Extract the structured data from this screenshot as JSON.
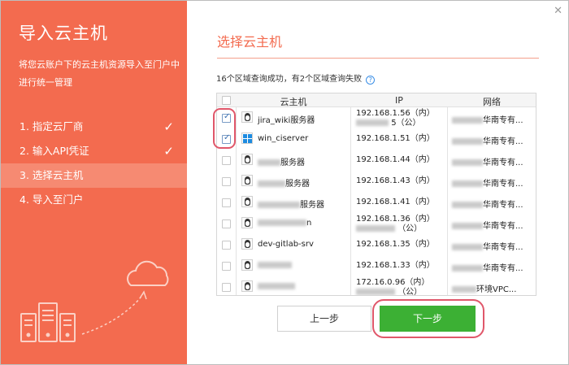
{
  "sidebar": {
    "title": "导入云主机",
    "description": "将您云账户下的云主机资源导入至门户中进行统一管理",
    "steps": [
      {
        "label": "1. 指定云厂商",
        "done": true
      },
      {
        "label": "2. 输入API凭证",
        "done": true
      },
      {
        "label": "3. 选择云主机",
        "active": true
      },
      {
        "label": "4. 导入至门户"
      }
    ],
    "check_glyph": "✓"
  },
  "main": {
    "title": "选择云主机",
    "status": "16个区域查询成功，有2个区域查询失败",
    "help_glyph": "?"
  },
  "table": {
    "headers": {
      "host": "云主机",
      "ip": "IP",
      "network": "网络"
    },
    "rows": [
      {
        "checked": true,
        "os": "linux",
        "name": "jira_wiki服务器",
        "ip": "192.168.1.56（内）",
        "ip2": "5（公）",
        "network": "华南专有..."
      },
      {
        "checked": true,
        "os": "windows",
        "name": "win_ciserver",
        "ip": "192.168.1.51（内）",
        "ip2": "",
        "network": "华南专有..."
      },
      {
        "checked": false,
        "os": "linux",
        "name": "服务器",
        "ip": "192.168.1.44（内）",
        "ip2": "",
        "network": "华南专有..."
      },
      {
        "checked": false,
        "os": "linux",
        "name": "服务器",
        "ip": "192.168.1.43（内）",
        "ip2": "",
        "network": "华南专有..."
      },
      {
        "checked": false,
        "os": "linux",
        "name": "服务器",
        "ip": "192.168.1.41（内）",
        "ip2": "",
        "network": "华南专有..."
      },
      {
        "checked": false,
        "os": "linux",
        "name": "n",
        "ip": "192.168.1.36（内）",
        "ip2": "（公）",
        "network": "华南专有..."
      },
      {
        "checked": false,
        "os": "linux",
        "name": "dev-gitlab-srv",
        "ip": "192.168.1.35（内）",
        "ip2": "",
        "network": "华南专有..."
      },
      {
        "checked": false,
        "os": "linux",
        "name": "",
        "ip": "192.168.1.33（内）",
        "ip2": "",
        "network": "华南专有..."
      },
      {
        "checked": false,
        "os": "linux",
        "name": "",
        "ip": "172.16.0.96（内）",
        "ip2": "（公）",
        "network": "环境VPC..."
      }
    ]
  },
  "buttons": {
    "prev": "上一步",
    "next": "下一步"
  },
  "colors": {
    "accent": "#f36b4f",
    "primary_button": "#3cb034",
    "highlight": "#e0576a"
  }
}
